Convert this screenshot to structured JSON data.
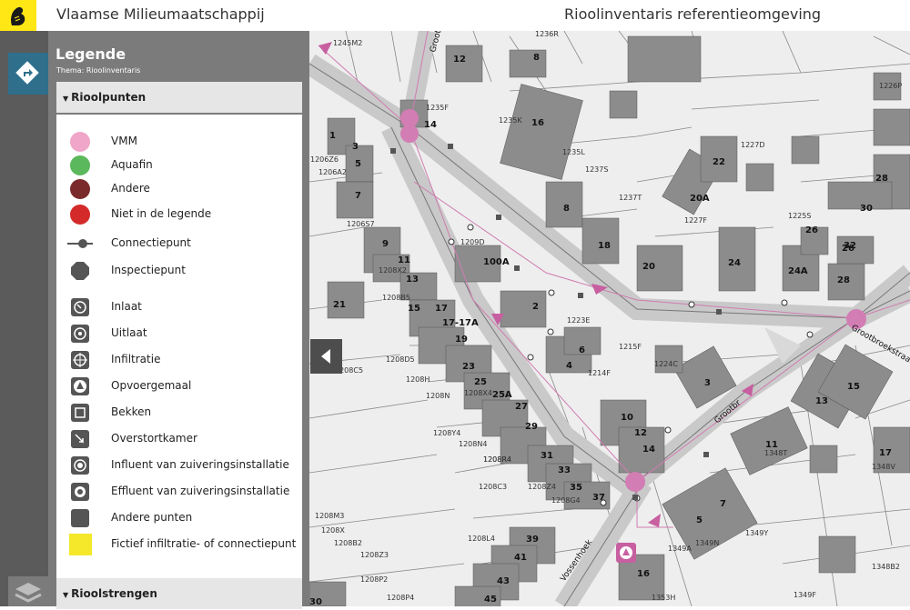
{
  "header": {
    "organization": "Vlaamse Milieumaatschappij",
    "application": "Rioolinventaris referentieomgeving"
  },
  "legend": {
    "title": "Legende",
    "theme": "Thema: Rioolinventaris",
    "section_points": "Rioolpunten",
    "section_lines": "Rioolstrengen",
    "items": [
      {
        "label": "VMM",
        "symbol": "circle",
        "color": "#f0a6c8"
      },
      {
        "label": "Aquafin",
        "symbol": "circle",
        "color": "#5cb85c"
      },
      {
        "label": "Andere",
        "symbol": "circle",
        "color": "#7a2a2a"
      },
      {
        "label": "Niet in de legende",
        "symbol": "circle",
        "color": "#d42a2a"
      },
      {
        "label": "Connectiepunt",
        "symbol": "connectiepunt"
      },
      {
        "label": "Inspectiepunt",
        "symbol": "octagon"
      },
      {
        "label": "Inlaat",
        "symbol": "inlaat"
      },
      {
        "label": "Uitlaat",
        "symbol": "uitlaat"
      },
      {
        "label": "Infiltratie",
        "symbol": "infiltratie"
      },
      {
        "label": "Opvoergemaal",
        "symbol": "opvoergemaal"
      },
      {
        "label": "Bekken",
        "symbol": "bekken"
      },
      {
        "label": "Overstortkamer",
        "symbol": "overstortkamer"
      },
      {
        "label": "Influent van zuiveringsinstallatie",
        "symbol": "influent"
      },
      {
        "label": "Effluent van zuiveringsinstallatie",
        "symbol": "effluent"
      },
      {
        "label": "Andere punten",
        "symbol": "square"
      },
      {
        "label": "Fictief infiltratie- of connectiepunt",
        "symbol": "yellow-square"
      }
    ]
  },
  "map": {
    "street_labels": [
      "Grootbroekstraat",
      "Grootbroekstraat",
      "Vossenhoek",
      "Grootbr"
    ],
    "house_numbers": [
      "12",
      "8",
      "14",
      "16",
      "1",
      "3",
      "5",
      "7",
      "9",
      "11",
      "13",
      "15",
      "17",
      "17-17A",
      "19",
      "21",
      "100A",
      "2",
      "4",
      "6",
      "8",
      "18",
      "20",
      "20A",
      "22",
      "24",
      "24A",
      "26",
      "26",
      "28",
      "28",
      "30",
      "32",
      "23",
      "25",
      "25A",
      "27",
      "29",
      "31",
      "33",
      "35",
      "37",
      "39",
      "41",
      "43",
      "45",
      "10",
      "12",
      "14",
      "3",
      "7",
      "5",
      "11",
      "13",
      "15",
      "17",
      "16",
      "30"
    ],
    "parcel_labels": [
      "1245M2",
      "1236R",
      "1235F",
      "1235K",
      "1235L",
      "1237S",
      "1237T",
      "1227D",
      "1227F",
      "1226P",
      "1225S",
      "1206Z6",
      "1206A2",
      "1206S7",
      "1209D",
      "1208X2",
      "1208B5",
      "1223E",
      "1215F",
      "1214F",
      "1224C",
      "1208C5",
      "1208D5",
      "1208H",
      "1208N",
      "1208X4",
      "1208Y4",
      "1208N4",
      "1208R4",
      "1208C3",
      "1208Z4",
      "1208G4",
      "1348T",
      "1348V",
      "1349Y",
      "1348B2",
      "1349A",
      "1349N",
      "1353H",
      "1208M3",
      "1208X",
      "1208B2",
      "1208Z3",
      "1208L4",
      "1208P2",
      "1208P4",
      "1349F",
      "1208R4"
    ]
  }
}
